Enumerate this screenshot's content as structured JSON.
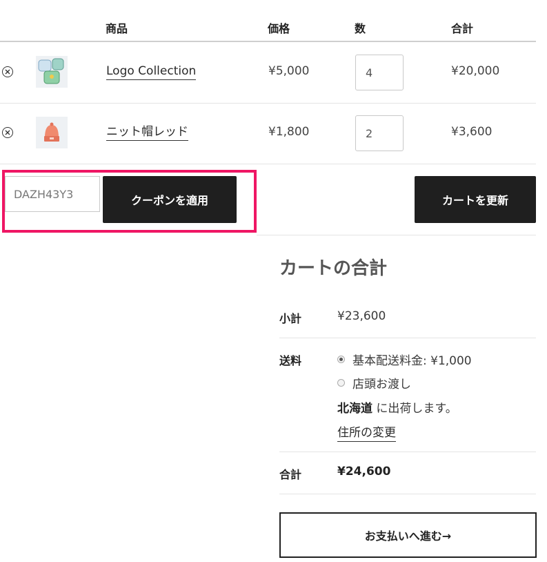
{
  "table": {
    "headers": {
      "product": "商品",
      "price": "価格",
      "quantity": "数",
      "subtotal": "合計"
    },
    "rows": [
      {
        "name": "Logo Collection",
        "price": "¥5,000",
        "qty": "4",
        "total": "¥20,000",
        "thumb": "hoodie-collection"
      },
      {
        "name": "ニット帽レッド",
        "price": "¥1,800",
        "qty": "2",
        "total": "¥3,600",
        "thumb": "red-beanie"
      }
    ]
  },
  "coupon": {
    "value": "DAZH43Y3",
    "apply_label": "クーポンを適用"
  },
  "update_cart_label": "カートを更新",
  "totals": {
    "title": "カートの合計",
    "subtotal_label": "小計",
    "subtotal_value": "¥23,600",
    "shipping_label": "送料",
    "shipping_options": [
      {
        "label": "基本配送料金: ¥1,000",
        "selected": true
      },
      {
        "label": "店頭お渡し",
        "selected": false
      }
    ],
    "ship_region": "北海道",
    "ship_suffix": " に出荷します。",
    "change_address_label": "住所の変更",
    "total_label": "合計",
    "total_value": "¥24,600"
  },
  "checkout_label": "お支払いへ進む→",
  "colors": {
    "highlight": "#ef1664",
    "button_dark": "#1f1f1f"
  }
}
